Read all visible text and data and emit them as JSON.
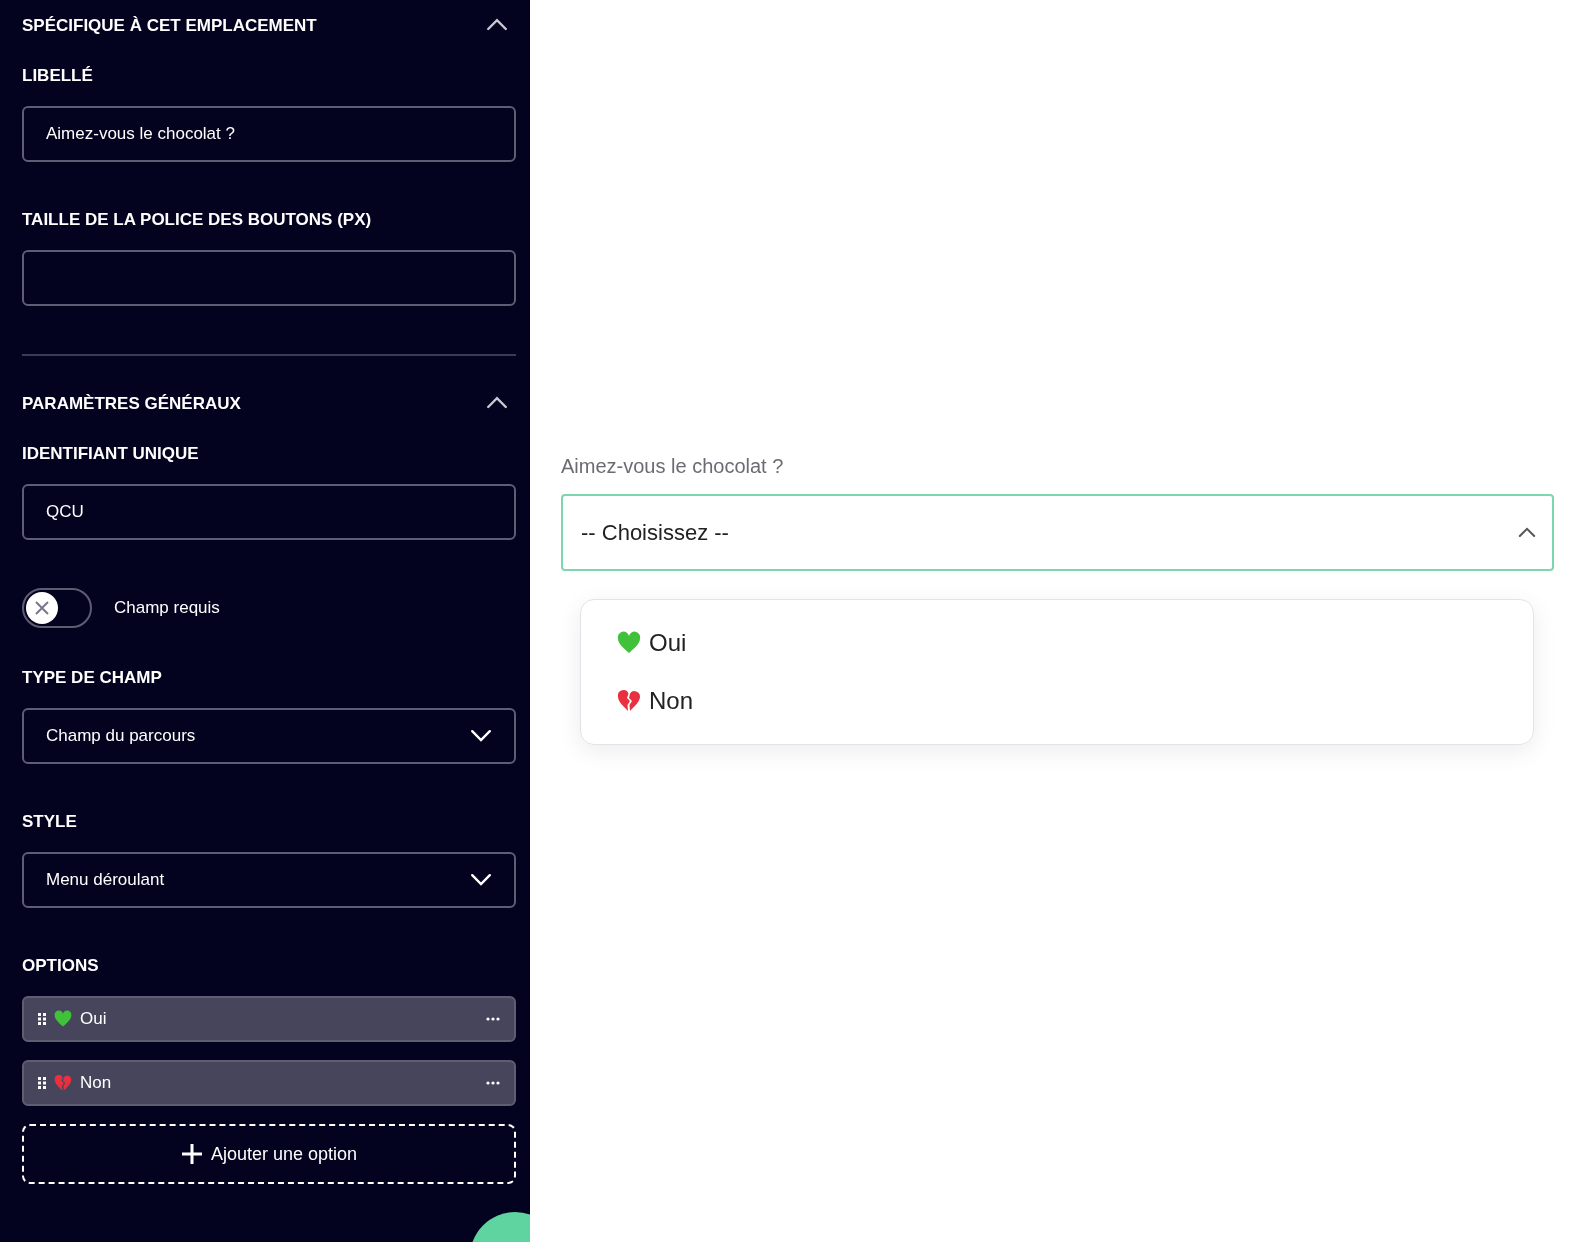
{
  "sidebar": {
    "sections": [
      {
        "title": "SPÉCIFIQUE À CET EMPLACEMENT",
        "expanded": true,
        "fields": [
          {
            "kind": "text",
            "label": "LIBELLÉ",
            "value": "Aimez-vous le chocolat ?"
          },
          {
            "kind": "text",
            "label": "TAILLE DE LA POLICE DES BOUTONS (PX)"
          }
        ]
      },
      {
        "title": "PARAMÈTRES GÉNÉRAUX",
        "expanded": true,
        "fields": [
          {
            "kind": "text",
            "label": "IDENTIFIANT UNIQUE",
            "value": "QCU"
          },
          {
            "kind": "toggle",
            "label": "Champ requis",
            "checked": false
          },
          {
            "kind": "select",
            "label": "TYPE DE CHAMP",
            "value": "Champ du parcours"
          },
          {
            "kind": "select",
            "label": "STYLE",
            "value": "Menu déroulant"
          },
          {
            "kind": "options",
            "label": "OPTIONS",
            "options": [
              {
                "kind": "heart",
                "label": "Oui"
              },
              {
                "kind": "broken_heart",
                "label": "Non"
              }
            ],
            "add_button": "Ajouter une option"
          }
        ]
      }
    ]
  },
  "preview": {
    "label": "Aimez-vous le chocolat ?",
    "select": {
      "placeholder": "-- Choisissez --",
      "expanded": true,
      "options": [
        {
          "kind": "heart",
          "label": "Oui"
        },
        {
          "kind": "broken_heart",
          "label": "Non"
        }
      ]
    }
  }
}
